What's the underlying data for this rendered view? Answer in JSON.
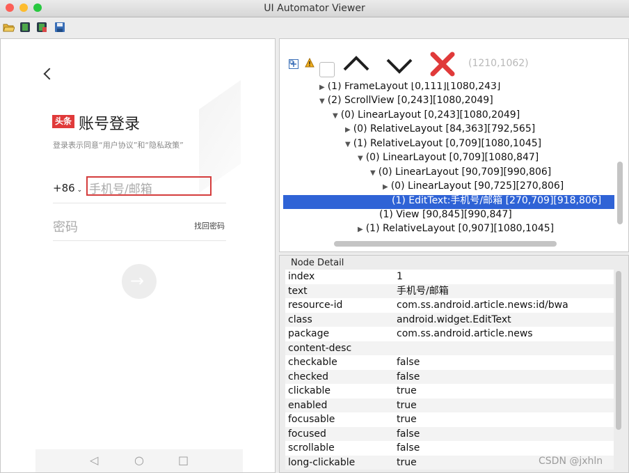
{
  "window": {
    "title": "UI Automator Viewer"
  },
  "device": {
    "login_title": "账号登录",
    "logo_text": "头条",
    "subtitle": "登录表示同意“用户协议”和“隐私政策”",
    "country_code": "+86",
    "phone_placeholder": "手机号/邮箱",
    "password_placeholder": "密码",
    "find_password": "找回密码",
    "go_arrow": "→",
    "nav": {
      "back": "◁",
      "home": "○",
      "recent": "□"
    }
  },
  "hierarchy": {
    "coords": "(1210,1062)",
    "nodes": [
      {
        "text": "(1) FrameLayout [0,111][1080,243]"
      },
      {
        "text": "(2) ScrollView [0,243][1080,2049]"
      },
      {
        "text": "(0) LinearLayout [0,243][1080,2049]"
      },
      {
        "text": "(0) RelativeLayout [84,363][792,565]"
      },
      {
        "text": "(1) RelativeLayout [0,709][1080,1045]"
      },
      {
        "text": "(0) LinearLayout [0,709][1080,847]"
      },
      {
        "text": "(0) LinearLayout [90,709][990,806]"
      },
      {
        "text": "(0) LinearLayout [90,725][270,806]"
      },
      {
        "text": "(1) EditText:手机号/邮箱 [270,709][918,806]"
      },
      {
        "text": "(1) View [90,845][990,847]"
      },
      {
        "text": "(1) RelativeLayout [0,907][1080,1045]"
      }
    ]
  },
  "detail": {
    "title": "Node Detail",
    "rows": [
      {
        "k": "index",
        "v": "1"
      },
      {
        "k": "text",
        "v": "手机号/邮箱"
      },
      {
        "k": "resource-id",
        "v": "com.ss.android.article.news:id/bwa"
      },
      {
        "k": "class",
        "v": "android.widget.EditText"
      },
      {
        "k": "package",
        "v": "com.ss.android.article.news"
      },
      {
        "k": "content-desc",
        "v": ""
      },
      {
        "k": "checkable",
        "v": "false"
      },
      {
        "k": "checked",
        "v": "false"
      },
      {
        "k": "clickable",
        "v": "true"
      },
      {
        "k": "enabled",
        "v": "true"
      },
      {
        "k": "focusable",
        "v": "true"
      },
      {
        "k": "focused",
        "v": "false"
      },
      {
        "k": "scrollable",
        "v": "false"
      },
      {
        "k": "long-clickable",
        "v": "true"
      }
    ]
  },
  "watermark": "CSDN @jxhln"
}
